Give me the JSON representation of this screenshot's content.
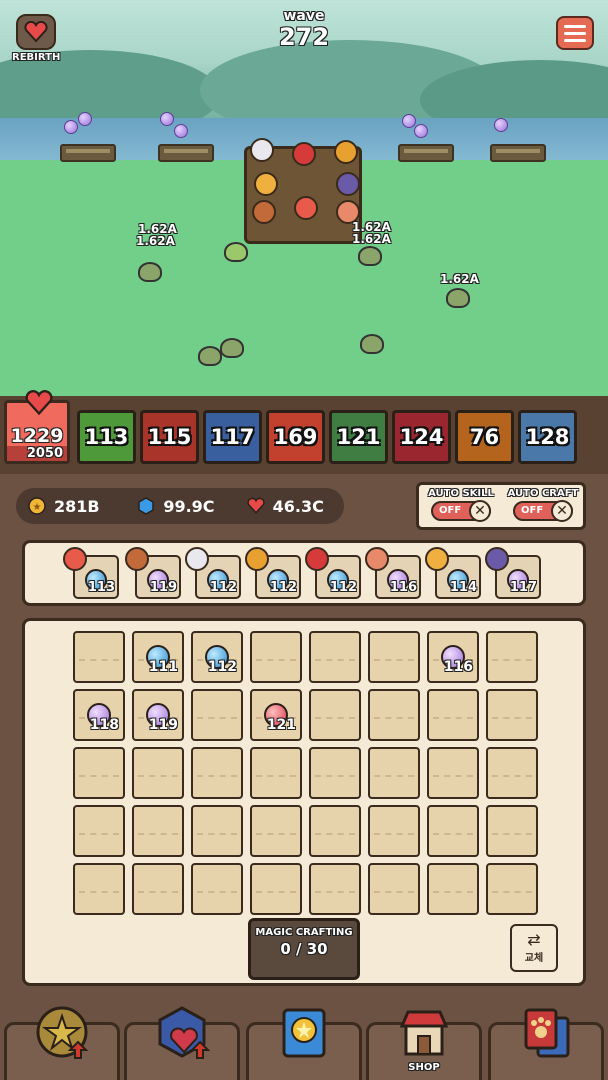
{
  "header": {
    "rebirth_label": "REBIRTH",
    "wave_label": "wave",
    "wave_number": "272"
  },
  "battle": {
    "damage_texts": [
      "1.62A",
      "1.62A",
      "1.62A",
      "1.62A",
      "1.62A"
    ]
  },
  "hero_bar": {
    "hp": "1229",
    "hp_max": "2050",
    "levels": [
      {
        "value": "113",
        "color": "#4e9a3a"
      },
      {
        "value": "115",
        "color": "#a8342a"
      },
      {
        "value": "117",
        "color": "#3a5f9e"
      },
      {
        "value": "169",
        "color": "#c2402e"
      },
      {
        "value": "121",
        "color": "#3f7d42"
      },
      {
        "value": "124",
        "color": "#9a2630"
      },
      {
        "value": "76",
        "color": "#b4641c"
      },
      {
        "value": "128",
        "color": "#4a78a8"
      }
    ]
  },
  "resources": {
    "gold": "281B",
    "gem": "99.9C",
    "heart": "46.3C"
  },
  "auto": {
    "skill_label": "AUTO SKILL",
    "skill_state": "OFF",
    "craft_label": "AUTO CRAFT",
    "craft_state": "OFF"
  },
  "hero_slots": [
    {
      "value": "113",
      "orb": "blue",
      "avatar": "#e85a4a"
    },
    {
      "value": "119",
      "orb": "purple",
      "avatar": "#c26a3a"
    },
    {
      "value": "112",
      "orb": "blue",
      "avatar": "#e8e8ee"
    },
    {
      "value": "112",
      "orb": "blue",
      "avatar": "#e8a030"
    },
    {
      "value": "112",
      "orb": "blue",
      "avatar": "#d63a3a"
    },
    {
      "value": "116",
      "orb": "purple",
      "avatar": "#e88a6a"
    },
    {
      "value": "114",
      "orb": "blue",
      "avatar": "#f0b040"
    },
    {
      "value": "117",
      "orb": "purple",
      "avatar": "#6a5aa8"
    }
  ],
  "grid": [
    [
      {
        "value": ""
      },
      {
        "value": "111",
        "orb": "blue"
      },
      {
        "value": "112",
        "orb": "blue"
      },
      {
        "value": ""
      },
      {
        "value": ""
      },
      {
        "value": ""
      },
      {
        "value": "116",
        "orb": "purple"
      },
      {
        "value": ""
      }
    ],
    [
      {
        "value": "118",
        "orb": "purple"
      },
      {
        "value": "119",
        "orb": "purple"
      },
      {
        "value": ""
      },
      {
        "value": "121",
        "orb": "red"
      },
      {
        "value": ""
      },
      {
        "value": ""
      },
      {
        "value": ""
      },
      {
        "value": ""
      }
    ],
    [
      {
        "value": ""
      },
      {
        "value": ""
      },
      {
        "value": ""
      },
      {
        "value": ""
      },
      {
        "value": ""
      },
      {
        "value": ""
      },
      {
        "value": ""
      },
      {
        "value": ""
      }
    ],
    [
      {
        "value": ""
      },
      {
        "value": ""
      },
      {
        "value": ""
      },
      {
        "value": ""
      },
      {
        "value": ""
      },
      {
        "value": ""
      },
      {
        "value": ""
      },
      {
        "value": ""
      }
    ],
    [
      {
        "value": ""
      },
      {
        "value": ""
      },
      {
        "value": ""
      },
      {
        "value": ""
      },
      {
        "value": ""
      },
      {
        "value": ""
      },
      {
        "value": ""
      },
      {
        "value": ""
      }
    ]
  ],
  "crafting": {
    "title": "MAGIC CRAFTING",
    "count": "0 / 30"
  },
  "swap": {
    "label": "교체"
  },
  "nav": {
    "shop_label": "SHOP"
  }
}
